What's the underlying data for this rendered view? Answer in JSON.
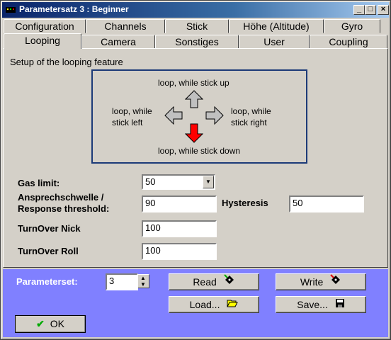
{
  "window": {
    "title": "Parametersatz 3 : Beginner"
  },
  "tabs_row1": [
    "Configuration",
    "Channels",
    "Stick",
    "Höhe (Altitude)",
    "Gyro"
  ],
  "tabs_row2": [
    "Looping",
    "Camera",
    "Sonstiges",
    "User",
    "Coupling"
  ],
  "active_tab": "Looping",
  "section": {
    "title": "Setup of the looping feature"
  },
  "diagram": {
    "up": "loop, while stick up",
    "left_1": "loop, while",
    "left_2": "stick left",
    "right_1": "loop, while",
    "right_2": "stick right",
    "down": "loop, while stick down",
    "active_direction": "down",
    "active_color": "#ff0000"
  },
  "fields": {
    "gas_limit": {
      "label": "Gas limit:",
      "value": "50"
    },
    "response": {
      "label_1": "Ansprechschwelle /",
      "label_2": "Response threshold:",
      "value": "90"
    },
    "hysteresis": {
      "label": "Hysteresis",
      "value": "50"
    },
    "turnover_nick": {
      "label": "TurnOver Nick",
      "value": "100"
    },
    "turnover_roll": {
      "label": "TurnOver Roll",
      "value": "100"
    }
  },
  "footer": {
    "parameterset_label": "Parameterset:",
    "parameterset_value": "3",
    "read_label": "Read",
    "write_label": "Write",
    "load_label": "Load...",
    "save_label": "Save...",
    "ok_label": "OK",
    "background_color": "#8080ff"
  }
}
